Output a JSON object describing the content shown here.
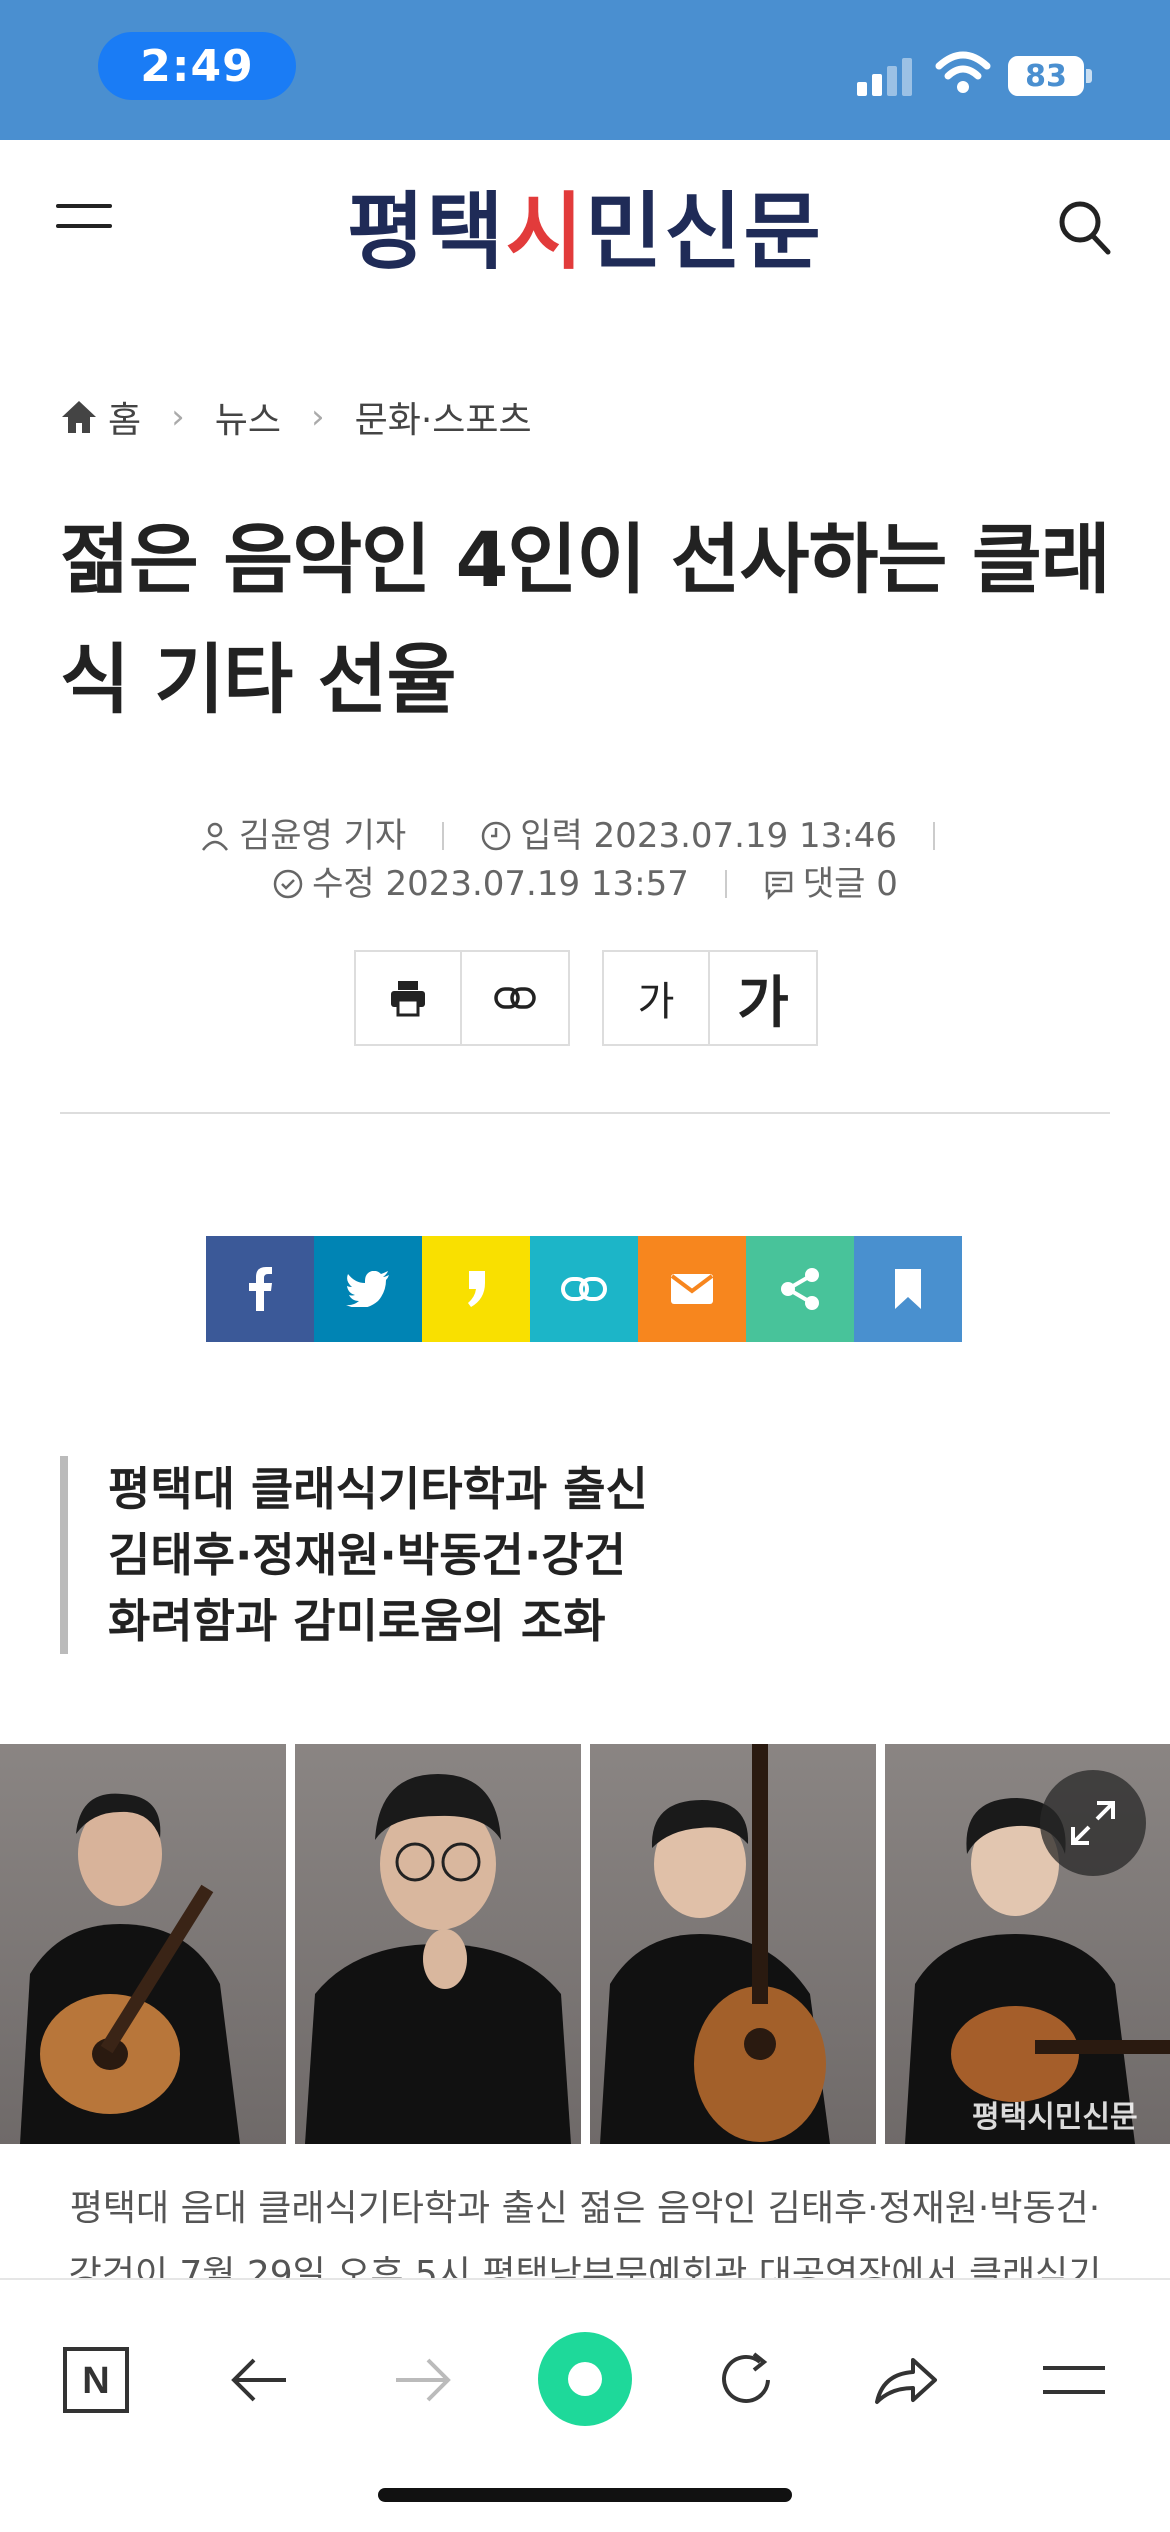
{
  "status_bar": {
    "time": "2:49",
    "battery": "83"
  },
  "header": {
    "logo_part1": "평택",
    "logo_part2": "시",
    "logo_part3": "민신문"
  },
  "breadcrumb": {
    "home": "홈",
    "level1": "뉴스",
    "level2": "문화·스포츠"
  },
  "article": {
    "title": "젊은 음악인 4인이 선사하는 클래식 기타 선율",
    "author": "김윤영 기자",
    "published": "입력 2023.07.19 13:46",
    "modified": "수정 2023.07.19 13:57",
    "comments": "댓글 0",
    "subhead": [
      "평택대 클래식기타학과 출신",
      "김태후·정재원·박동건·강건",
      "화려함과 감미로움의 조화"
    ],
    "photo_watermark": "평택시민신문",
    "body_line1": "평택대 음대 클래식기타학과 출신 젊은 음악인 김태후·정재원·박동건·",
    "body_line2": "강건이 7월 29일 오후 5시 평택남부문예회관 대공연장에서 클래식기"
  },
  "tools": {
    "font_small": "가",
    "font_large": "가"
  },
  "share_colors": {
    "facebook": "#3b5998",
    "twitter": "#0084b4",
    "kakao": "#f9e000",
    "link": "#1cb5c8",
    "email": "#f7861e",
    "share": "#48c39a",
    "bookmark": "#4990cf"
  },
  "icons": [
    "home-icon",
    "search-icon",
    "menu-icon",
    "user-icon",
    "clock-icon",
    "check-icon",
    "comment-icon",
    "print-icon",
    "link-icon",
    "facebook-icon",
    "twitter-icon",
    "kakao-icon",
    "email-icon",
    "share-icon",
    "bookmark-icon",
    "expand-icon",
    "back-icon",
    "forward-icon",
    "reload-icon"
  ],
  "bottom_nav": {
    "n_label": "N"
  }
}
